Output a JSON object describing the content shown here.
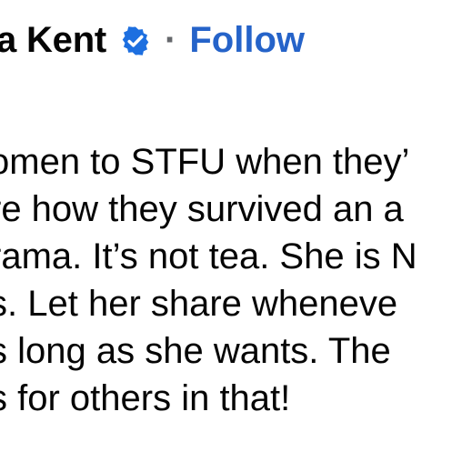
{
  "post": {
    "author_name": "a Kent",
    "verified_icon": "verified-badge-icon",
    "separator": "·",
    "follow_label": "Follow",
    "body_lines": [
      "omen to STFU when they’",
      "re how they survived an a",
      "rama. It’s not tea. She is N",
      "s. Let her share wheneve",
      "s long as she wants. The",
      "s for others in that!"
    ]
  },
  "colors": {
    "text": "#050505",
    "follow_link": "#2563c9",
    "verified_badge": "#1d6fe0",
    "separator": "#65676b",
    "background": "#ffffff"
  }
}
